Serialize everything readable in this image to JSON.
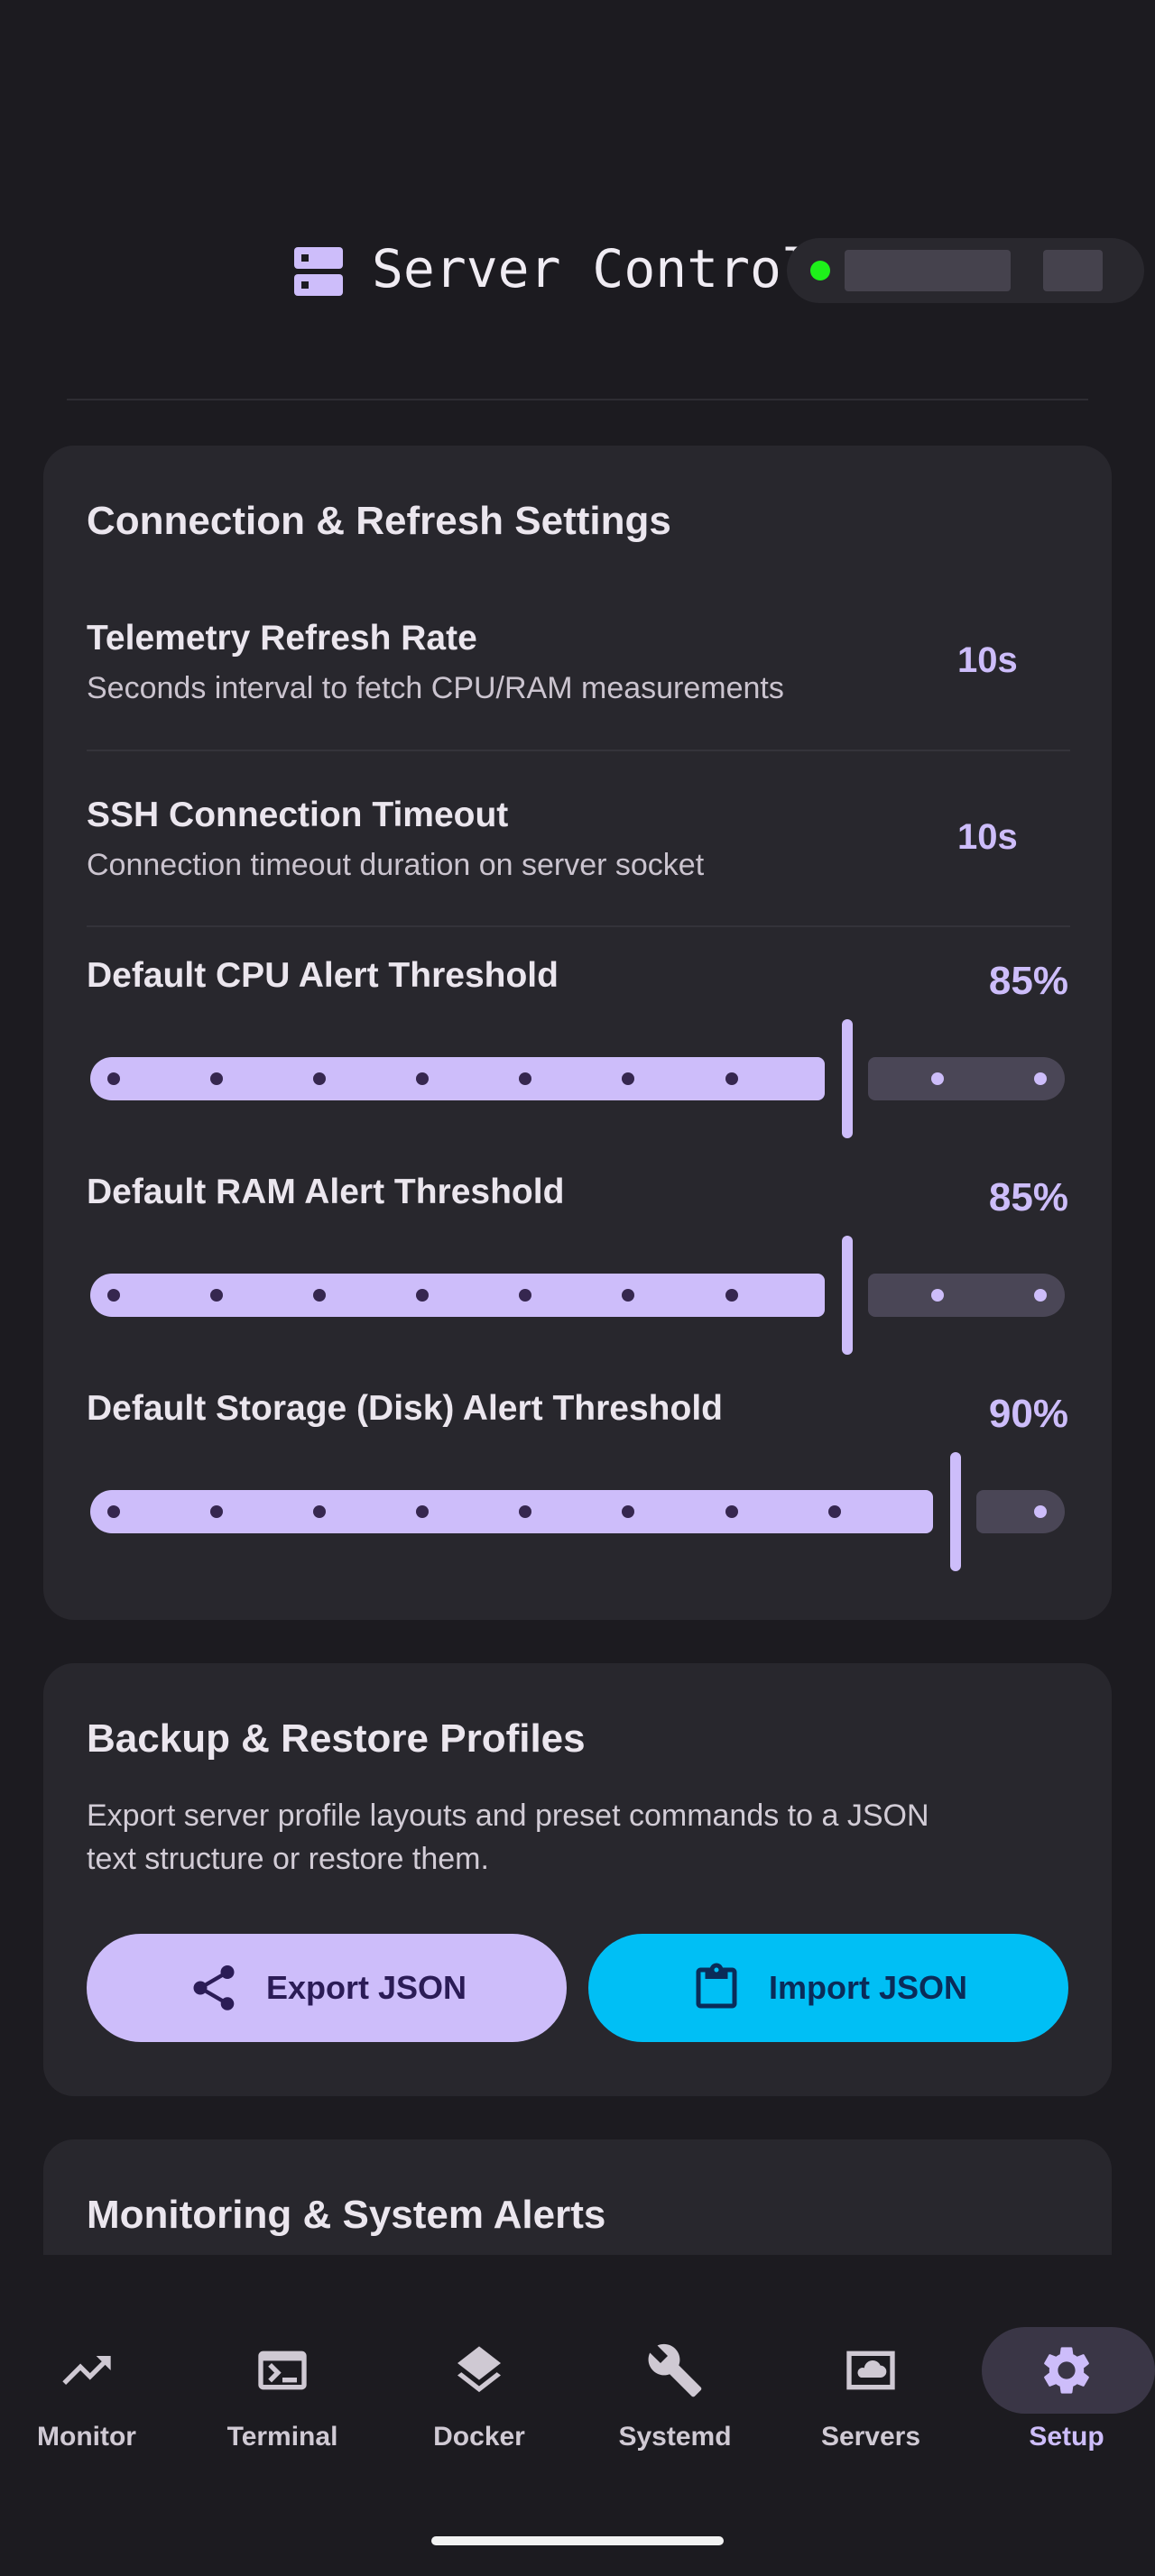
{
  "header": {
    "title": "Server Control",
    "status_color": "#1ef01a",
    "icon": "server-icon"
  },
  "connection_card": {
    "title": "Connection & Refresh Settings",
    "telemetry": {
      "title": "Telemetry Refresh Rate",
      "description": "Seconds interval to fetch CPU/RAM measurements",
      "value": "10s"
    },
    "ssh_timeout": {
      "title": "SSH Connection Timeout",
      "description": "Connection timeout duration on server socket",
      "value": "10s"
    },
    "cpu_threshold": {
      "title": "Default CPU Alert Threshold",
      "value": "85%",
      "level": 85
    },
    "ram_threshold": {
      "title": "Default RAM Alert Threshold",
      "value": "85%",
      "level": 85
    },
    "storage_threshold": {
      "title": "Default Storage (Disk) Alert Threshold",
      "value": "90%",
      "level": 90
    }
  },
  "backup_card": {
    "title": "Backup & Restore Profiles",
    "description_line1": "Export server profile layouts and preset commands to a JSON",
    "description_line2": "text structure or restore them.",
    "export_label": "Export JSON",
    "import_label": "Import JSON",
    "export_icon": "share-icon",
    "import_icon": "clipboard-icon"
  },
  "monitoring_card": {
    "title": "Monitoring & System Alerts"
  },
  "nav": {
    "items": [
      {
        "label": "Monitor",
        "icon": "trending-up-icon"
      },
      {
        "label": "Terminal",
        "icon": "terminal-icon"
      },
      {
        "label": "Docker",
        "icon": "layers-icon"
      },
      {
        "label": "Systemd",
        "icon": "wrench-icon"
      },
      {
        "label": "Servers",
        "icon": "cloud-box-icon"
      },
      {
        "label": "Setup",
        "icon": "gear-icon"
      }
    ],
    "active": "Setup"
  },
  "colors": {
    "background": "#1c1b20",
    "card": "#28272d",
    "accent": "#cdbdfa",
    "import_button": "#00bff5"
  }
}
